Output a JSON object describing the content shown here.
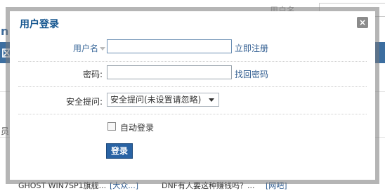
{
  "background": {
    "top_link": "用户名",
    "left_letter": "n",
    "nav_text": "区",
    "side_text": "员",
    "bottom_items": [
      "GHOST  WIN7SP1旗舰...",
      "[大众...]",
      "DNF有人要这种赚钱吗？...",
      "[网吧]"
    ]
  },
  "modal": {
    "title": "用户登录",
    "close_glyph": "×",
    "username": {
      "label": "用户名",
      "value": "",
      "register_link": "立即注册"
    },
    "password": {
      "label": "密码:",
      "value": "",
      "forgot_link": "找回密码"
    },
    "security": {
      "label": "安全提问:",
      "selected": "安全提问(未设置请忽略)"
    },
    "auto_login": {
      "label": "自动登录",
      "checked": false
    },
    "submit_label": "登录"
  },
  "colors": {
    "accent": "#2963a4",
    "title": "#14558f",
    "link": "#2f5c90"
  }
}
